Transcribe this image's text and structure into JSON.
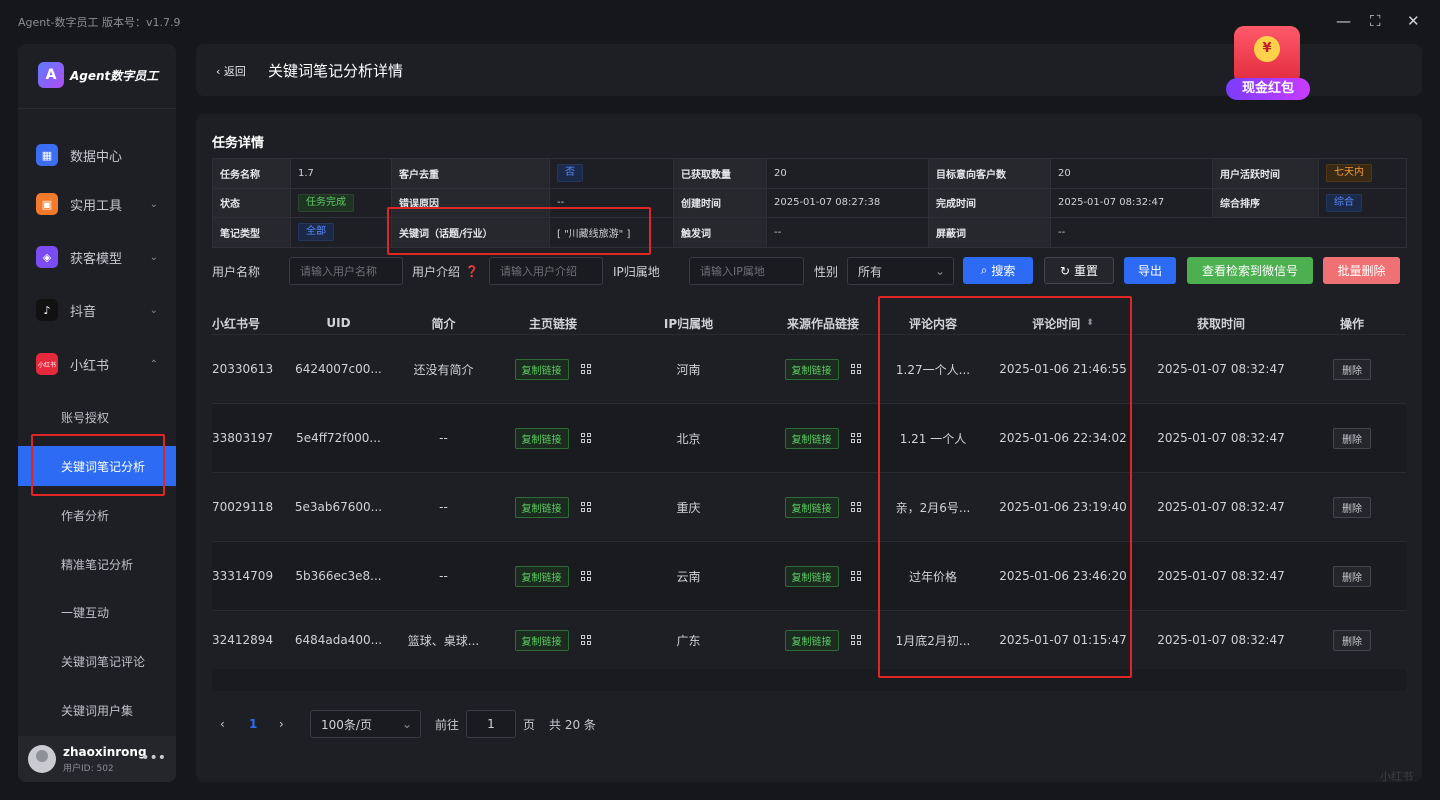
{
  "app": {
    "title": "Agent-数字员工 版本号：v1.7.9",
    "brand": "Agent数字员工",
    "brand_mark": "A"
  },
  "window": {
    "min": "—",
    "max": "⛶",
    "close": "✕"
  },
  "sidebar": {
    "items": [
      {
        "label": "数据中心",
        "color": "#3b6df5",
        "glyph": "▦"
      },
      {
        "label": "实用工具",
        "color": "#f27a2a",
        "glyph": "▣"
      },
      {
        "label": "获客模型",
        "color": "#7a4cf2",
        "glyph": "◈"
      },
      {
        "label": "抖音",
        "color": "#111111",
        "glyph": "♪"
      },
      {
        "label": "小红书",
        "color": "#e6283c",
        "glyph": "小红书"
      }
    ],
    "subitems": [
      "账号授权",
      "关键词笔记分析",
      "作者分析",
      "精准笔记分析",
      "一键互动",
      "关键词笔记评论",
      "关键词用户集"
    ],
    "user": {
      "name": "zhaoxinrong",
      "id": "用户ID: 502"
    }
  },
  "header": {
    "back": "返回",
    "title": "关键词笔记分析详情"
  },
  "promo": {
    "label": "现金红包",
    "coin": "¥"
  },
  "task": {
    "section_title": "任务详情",
    "rows": [
      [
        {
          "l": "任务名称",
          "v": "1.7"
        },
        {
          "l": "客户去重",
          "v": "否",
          "tag": "blue"
        },
        {
          "l": "已获取数量",
          "v": "20"
        },
        {
          "l": "目标意向客户数",
          "v": "20"
        },
        {
          "l": "用户活跃时间",
          "v": "七天内",
          "tag": "orange"
        }
      ],
      [
        {
          "l": "状态",
          "v": "任务完成",
          "tag": "green"
        },
        {
          "l": "错误原因",
          "v": "--"
        },
        {
          "l": "创建时间",
          "v": "2025-01-07 08:27:38"
        },
        {
          "l": "完成时间",
          "v": "2025-01-07 08:32:47"
        },
        {
          "l": "综合排序",
          "v": "综合",
          "tag": "blue"
        }
      ],
      [
        {
          "l": "笔记类型",
          "v": "全部",
          "tag": "blue"
        },
        {
          "l": "关键词（话题/行业）",
          "v": "[ \"川藏线旅游\" ]"
        },
        {
          "l": "触发词",
          "v": "--"
        },
        {
          "l": "屏蔽词",
          "v": "--"
        }
      ]
    ]
  },
  "filters": {
    "username_label": "用户名称",
    "username_ph": "请输入用户名称",
    "intro_label": "用户介绍",
    "intro_ph": "请输入用户介绍",
    "ip_label": "IP归属地",
    "ip_ph": "请输入IP属地",
    "gender_label": "性别",
    "gender_value": "所有",
    "search": "搜索",
    "reset": "重置",
    "export": "导出",
    "view_wechat": "查看检索到微信号",
    "batch_delete": "批量删除"
  },
  "table": {
    "headers": [
      "小红书号",
      "UID",
      "简介",
      "主页链接",
      "IP归属地",
      "来源作品链接",
      "评论内容",
      "评论时间",
      "获取时间",
      "操作"
    ],
    "copy_label": "复制链接",
    "delete_label": "删除",
    "rows": [
      {
        "xhs": "20330613",
        "uid": "6424007c00...",
        "intro": "还没有简介",
        "ip": "河南",
        "comment": "1.27一个人...",
        "ctime": "2025-01-06 21:46:55",
        "gtime": "2025-01-07 08:32:47"
      },
      {
        "xhs": "33803197",
        "uid": "5e4ff72f000...",
        "intro": "--",
        "ip": "北京",
        "comment": "1.21 一个人",
        "ctime": "2025-01-06 22:34:02",
        "gtime": "2025-01-07 08:32:47"
      },
      {
        "xhs": "70029118",
        "uid": "5e3ab67600...",
        "intro": "--",
        "ip": "重庆",
        "comment": "亲，2月6号...",
        "ctime": "2025-01-06 23:19:40",
        "gtime": "2025-01-07 08:32:47"
      },
      {
        "xhs": "33314709",
        "uid": "5b366ec3e8...",
        "intro": "--",
        "ip": "云南",
        "comment": "过年价格",
        "ctime": "2025-01-06 23:46:20",
        "gtime": "2025-01-07 08:32:47"
      },
      {
        "xhs": "32412894",
        "uid": "6484ada400...",
        "intro": "篮球、桌球...",
        "ip": "广东",
        "comment": "1月底2月初...",
        "ctime": "2025-01-07 01:15:47",
        "gtime": "2025-01-07 08:32:47"
      }
    ]
  },
  "pagination": {
    "prev": "‹",
    "page": "1",
    "next": "›",
    "page_size": "100条/页",
    "goto_label": "前往",
    "goto_value": "1",
    "page_unit": "页",
    "total": "共 20 条"
  },
  "watermark": "小红书"
}
